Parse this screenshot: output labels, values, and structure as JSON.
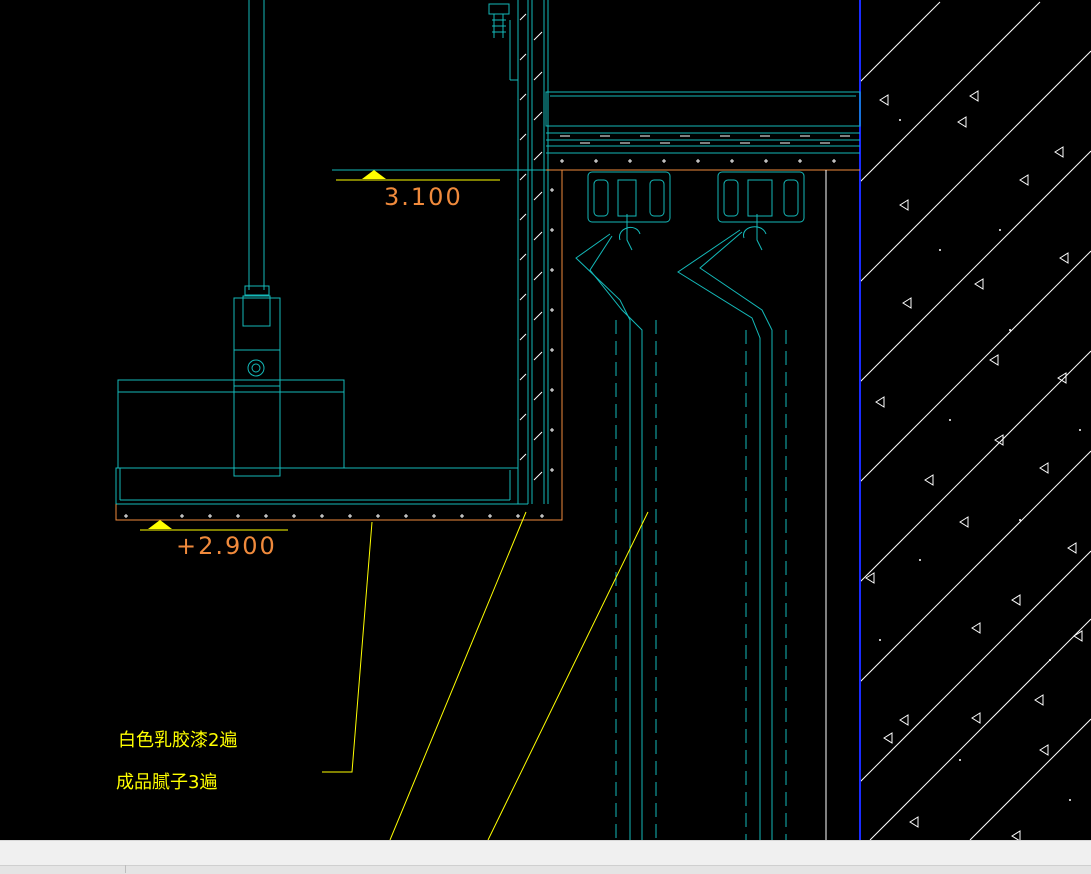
{
  "drawing": {
    "level_upper": "3.100",
    "level_lower": "+2.900",
    "note_line1": "白色乳胶漆2遍",
    "note_line2": "成品腻子3遍",
    "colors": {
      "background": "#000000",
      "cyan": "#14b9b9",
      "yellow": "#ffff00",
      "orange": "#f08a3c",
      "blue": "#1a2bff",
      "white": "#ffffff"
    }
  },
  "status_bar": {
    "text": ""
  }
}
